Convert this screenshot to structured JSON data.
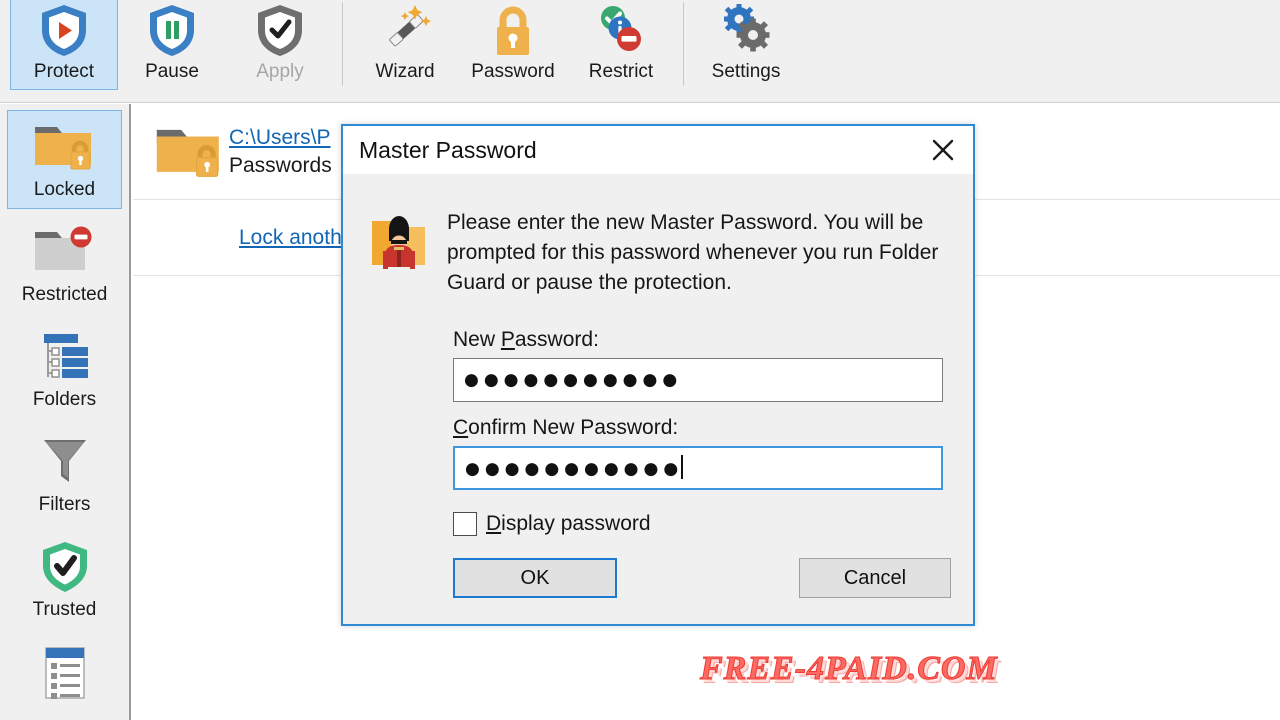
{
  "app": {
    "name": "Folder Guard",
    "accent_blue": "#2f8ad6",
    "selection_blue": "#cce4f7",
    "link_blue": "#1266b5"
  },
  "toolbar": {
    "items": [
      {
        "label": "Protect",
        "icon": "shield-play-icon",
        "state": "selected"
      },
      {
        "label": "Pause",
        "icon": "shield-pause-icon",
        "state": "normal"
      },
      {
        "label": "Apply",
        "icon": "shield-check-gray-icon",
        "state": "disabled"
      },
      {
        "label": "Wizard",
        "icon": "magic-wand-icon",
        "state": "normal"
      },
      {
        "label": "Password",
        "icon": "padlock-icon",
        "state": "normal"
      },
      {
        "label": "Restrict",
        "icon": "restrict-circles-icon",
        "state": "normal"
      },
      {
        "label": "Settings",
        "icon": "gears-icon",
        "state": "normal"
      }
    ]
  },
  "sidebar": {
    "items": [
      {
        "label": "Locked",
        "icon": "folder-locked-icon",
        "state": "selected"
      },
      {
        "label": "Restricted",
        "icon": "folder-restricted-icon",
        "state": "normal"
      },
      {
        "label": "Folders",
        "icon": "folder-tree-icon",
        "state": "normal"
      },
      {
        "label": "Filters",
        "icon": "funnel-icon",
        "state": "normal"
      },
      {
        "label": "Trusted",
        "icon": "shield-check-green-icon",
        "state": "normal"
      },
      {
        "label": "",
        "icon": "report-list-icon",
        "state": "normal"
      }
    ]
  },
  "content": {
    "entry": {
      "path": "C:\\Users\\P",
      "subtitle": "Passwords",
      "icon": "folder-locked-icon"
    },
    "action_link": "Lock anoth"
  },
  "dialog": {
    "title": "Master Password",
    "close_label": "✕",
    "prompt_icon": "folder-guard-person-icon",
    "prompt_text": "Please enter the new Master Password. You will be prompted for this password whenever you run Folder Guard or pause the protection.",
    "new_password": {
      "label_before": "New ",
      "label_accesskey": "P",
      "label_after": "assword:",
      "value_masked": "●●●●●●●●●●●",
      "focused": false
    },
    "confirm_password": {
      "label_accesskey": "C",
      "label_after": "onfirm New Password:",
      "value_masked": "●●●●●●●●●●●",
      "focused": true
    },
    "display_password": {
      "label_accesskey": "D",
      "label_after": "isplay password",
      "checked": false
    },
    "ok_label": "OK",
    "cancel_label": "Cancel"
  },
  "watermark": {
    "text": "FREE-4PAID.COM",
    "color": "#fb6a63"
  }
}
